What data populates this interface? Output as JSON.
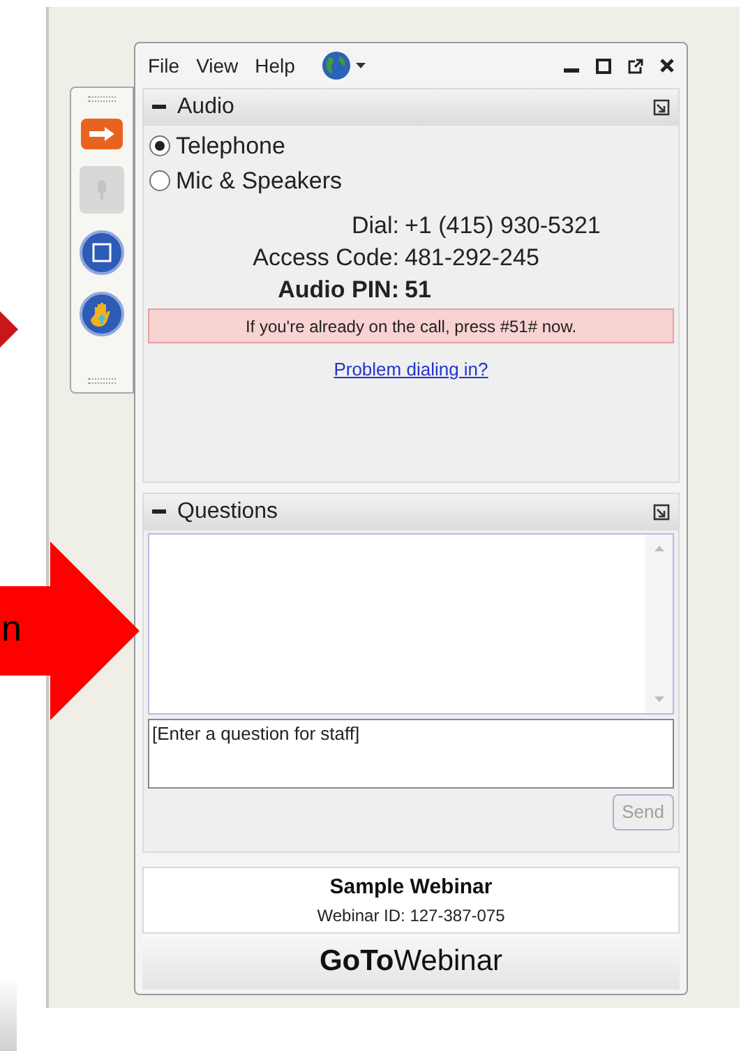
{
  "callouts": [
    {
      "kind": "tip"
    },
    {
      "kind": "arrow",
      "label": "n"
    }
  ],
  "toolbar": [
    {
      "kind": "arrow"
    },
    {
      "kind": "microphone"
    },
    {
      "kind": "screen"
    },
    {
      "kind": "hand"
    }
  ],
  "menu": [
    "File",
    "View",
    "Help"
  ],
  "audio": {
    "title": "Audio",
    "options": [
      {
        "label": "Telephone",
        "selected": true
      },
      {
        "label": "Mic & Speakers",
        "selected": false
      }
    ],
    "lines": [
      {
        "label": "Dial:",
        "value": "+1 (415) 930-5321",
        "bold": false
      },
      {
        "label": "Access Code:",
        "value": "481-292-245",
        "bold": false
      },
      {
        "label": "Audio PIN:",
        "value": "51",
        "bold": true
      }
    ],
    "notice": "If you're already on the call, press #51# now.",
    "link": "Problem dialing in?"
  },
  "questions": {
    "title": "Questions",
    "placeholder": "[Enter a question for staff]",
    "send": {
      "label": "Send",
      "disabled": true
    }
  },
  "webinar": {
    "name": "Sample Webinar",
    "id": "Webinar ID: 127-387-075"
  },
  "brand": {
    "bold": "GoTo",
    "regular": "Webinar"
  }
}
